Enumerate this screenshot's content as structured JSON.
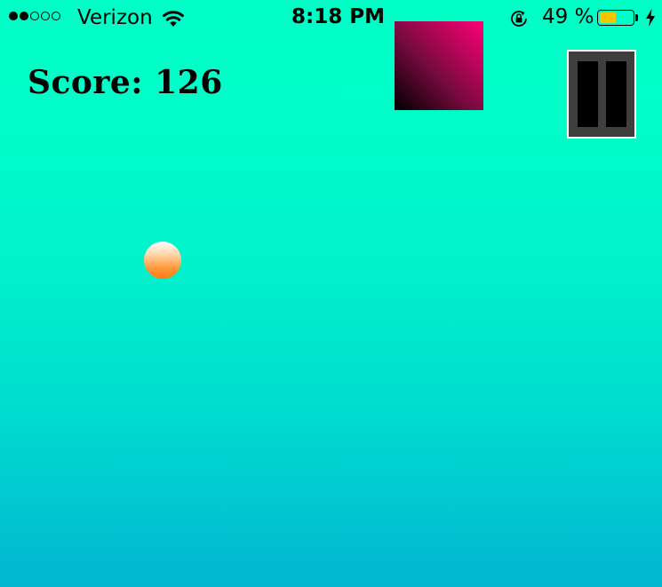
{
  "status_bar": {
    "carrier": "Verizon",
    "signal_bars_filled": 2,
    "signal_bars_total": 5,
    "time": "8:18 PM",
    "battery_percent": "49 %",
    "battery_level": 0.49,
    "battery_color": "#f7c600",
    "icons": [
      "wifi-icon",
      "rotation-lock-icon",
      "charging-bolt-icon"
    ]
  },
  "hud": {
    "score_label": "Score: 126",
    "score": 126
  },
  "colors": {
    "background_top": "#00ffc6",
    "background_bottom": "#02b6d2",
    "block_light": "#ff0077",
    "block_dark": "#000000",
    "ball": "#ff7a12",
    "pause_button_bg": "#3f3f3f"
  }
}
